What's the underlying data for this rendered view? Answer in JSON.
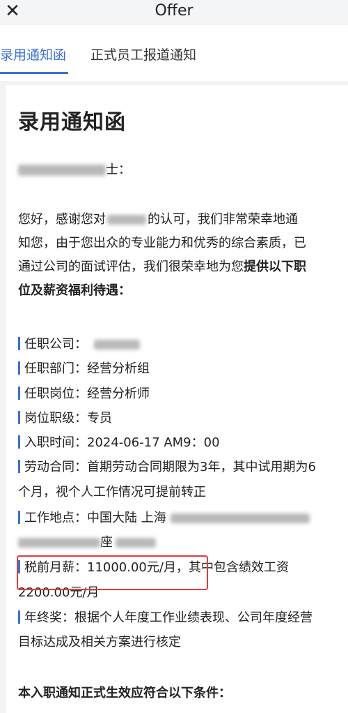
{
  "topbar": {
    "title": "Offer",
    "close": "✕",
    "more": "···"
  },
  "tabs": [
    "录用通知函",
    "正式员工报道通知"
  ],
  "letter": {
    "title": "录用通知函",
    "greeting_suffix": "士：",
    "para1": "您好，感谢您对",
    "para1b": "的认可，我们非常荣幸地通",
    "para2": "知您，由于您出众的专业能力和优秀的综合素质，已",
    "para3a": "通过公司的面试评估，我们很荣幸地为您",
    "para3b": "提供以下职",
    "para4": "位及薪资福利待遇：",
    "items": [
      {
        "label": "任职公司：",
        "value": ""
      },
      {
        "label": "任职部门：",
        "value": "经营分析组"
      },
      {
        "label": "任职岗位：",
        "value": "经营分析师"
      },
      {
        "label": "岗位职级：",
        "value": "专员"
      },
      {
        "label": "入职时间：",
        "value": "2024-06-17  AM9：00"
      },
      {
        "label": "劳动合同：",
        "value": "首期劳动合同期限为3年，其中试用期为6"
      },
      {
        "label": "",
        "value": "个月，视个人工作情况可提前转正"
      },
      {
        "label": "工作地点：",
        "value": "中国大陆 上海"
      },
      {
        "label": "",
        "value": "座"
      },
      {
        "label": "税前月薪：",
        "value": "11000.00元/月，其中包含绩效工资"
      },
      {
        "label": "",
        "value": "2200.00元/月"
      },
      {
        "label": "年终奖：",
        "value": "根据个人年度工作业绩表现、公司年度经营"
      },
      {
        "label": "",
        "value": "目标达成及相关方案进行核定"
      }
    ],
    "footer": "本入职通知正式生效应符合以下条件："
  },
  "colors": {
    "accent": "#3b6fd6",
    "highlight": "#e33b3b"
  }
}
